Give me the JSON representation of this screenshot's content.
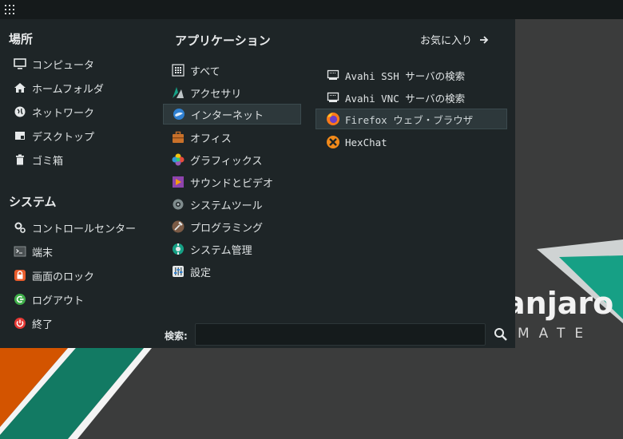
{
  "places": {
    "title": "場所",
    "items": [
      {
        "label": "コンピュータ"
      },
      {
        "label": "ホームフォルダ"
      },
      {
        "label": "ネットワーク"
      },
      {
        "label": "デスクトップ"
      },
      {
        "label": "ゴミ箱"
      }
    ]
  },
  "system": {
    "title": "システム",
    "items": [
      {
        "label": "コントロールセンター"
      },
      {
        "label": "端末"
      },
      {
        "label": "画面のロック"
      },
      {
        "label": "ログアウト"
      },
      {
        "label": "終了"
      }
    ]
  },
  "applications": {
    "title": "アプリケーション",
    "favorites_label": "お気に入り",
    "categories": [
      {
        "label": "すべて"
      },
      {
        "label": "アクセサリ"
      },
      {
        "label": "インターネット"
      },
      {
        "label": "オフィス"
      },
      {
        "label": "グラフィックス"
      },
      {
        "label": "サウンドとビデオ"
      },
      {
        "label": "システムツール"
      },
      {
        "label": "プログラミング"
      },
      {
        "label": "システム管理"
      },
      {
        "label": "設定"
      }
    ],
    "selected_category": "インターネット",
    "apps": [
      {
        "label": "Avahi SSH サーバの検索"
      },
      {
        "label": "Avahi VNC サーバの検索"
      },
      {
        "label": "Firefox ウェブ・ブラウザ"
      },
      {
        "label": "HexChat"
      }
    ],
    "selected_app": "Firefox ウェブ・ブラウザ"
  },
  "search": {
    "label": "検索:",
    "value": ""
  },
  "wallpaper": {
    "brand": "anjaro",
    "edition": "MATE"
  },
  "colors": {
    "accent": "#16a085",
    "orange": "#d35400",
    "menu_bg": "#1e2527"
  }
}
